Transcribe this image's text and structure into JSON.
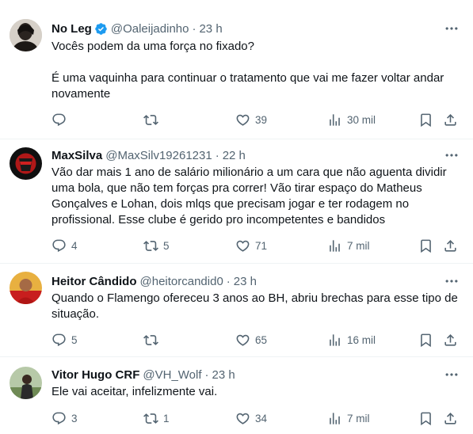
{
  "tweets": [
    {
      "name": "No Leg",
      "verified": true,
      "handle": "@Oaleijadinho",
      "time": "23 h",
      "text_line1": "Vocês podem da uma força no fixado?",
      "text_line2": "É uma vaquinha para continuar o tratamento que vai me fazer voltar andar novamente",
      "replies": "",
      "retweets": "",
      "likes": "39",
      "views": "30 mil"
    },
    {
      "name": "MaxSilva",
      "verified": false,
      "handle": "@MaxSilv19261231",
      "time": "22 h",
      "text_line1": "Vão dar mais 1 ano de salário milionário a um cara que não aguenta dividir uma bola, que não tem forças pra correr! Vão tirar espaço do Matheus Gonçalves e Lohan, dois mlqs que precisam jogar e ter rodagem no profissional. Esse clube é gerido pro incompetentes e bandidos",
      "replies": "4",
      "retweets": "5",
      "likes": "71",
      "views": "7 mil"
    },
    {
      "name": "Heitor Cândido",
      "verified": false,
      "handle": "@heitorcandid0",
      "time": "23 h",
      "text_line1": "Quando o Flamengo ofereceu 3 anos ao BH, abriu brechas para esse tipo de situação.",
      "replies": "5",
      "retweets": "",
      "likes": "65",
      "views": "16 mil"
    },
    {
      "name": "Vitor Hugo CRF",
      "verified": false,
      "handle": "@VH_Wolf",
      "time": "23 h",
      "text_line1": "Ele vai aceitar, infelizmente vai.",
      "replies": "3",
      "retweets": "1",
      "likes": "34",
      "views": "7 mil"
    }
  ],
  "separator": "·",
  "icons": {
    "reply": "reply-icon",
    "retweet": "retweet-icon",
    "like": "heart-icon",
    "views": "views-chart-icon",
    "bookmark": "bookmark-icon",
    "share": "share-icon",
    "more": "more-options-icon",
    "verified": "verified-badge-icon"
  },
  "colors": {
    "text": "#0f1419",
    "secondary": "#536471",
    "verified": "#1d9bf0",
    "divider": "#eff3f4"
  }
}
